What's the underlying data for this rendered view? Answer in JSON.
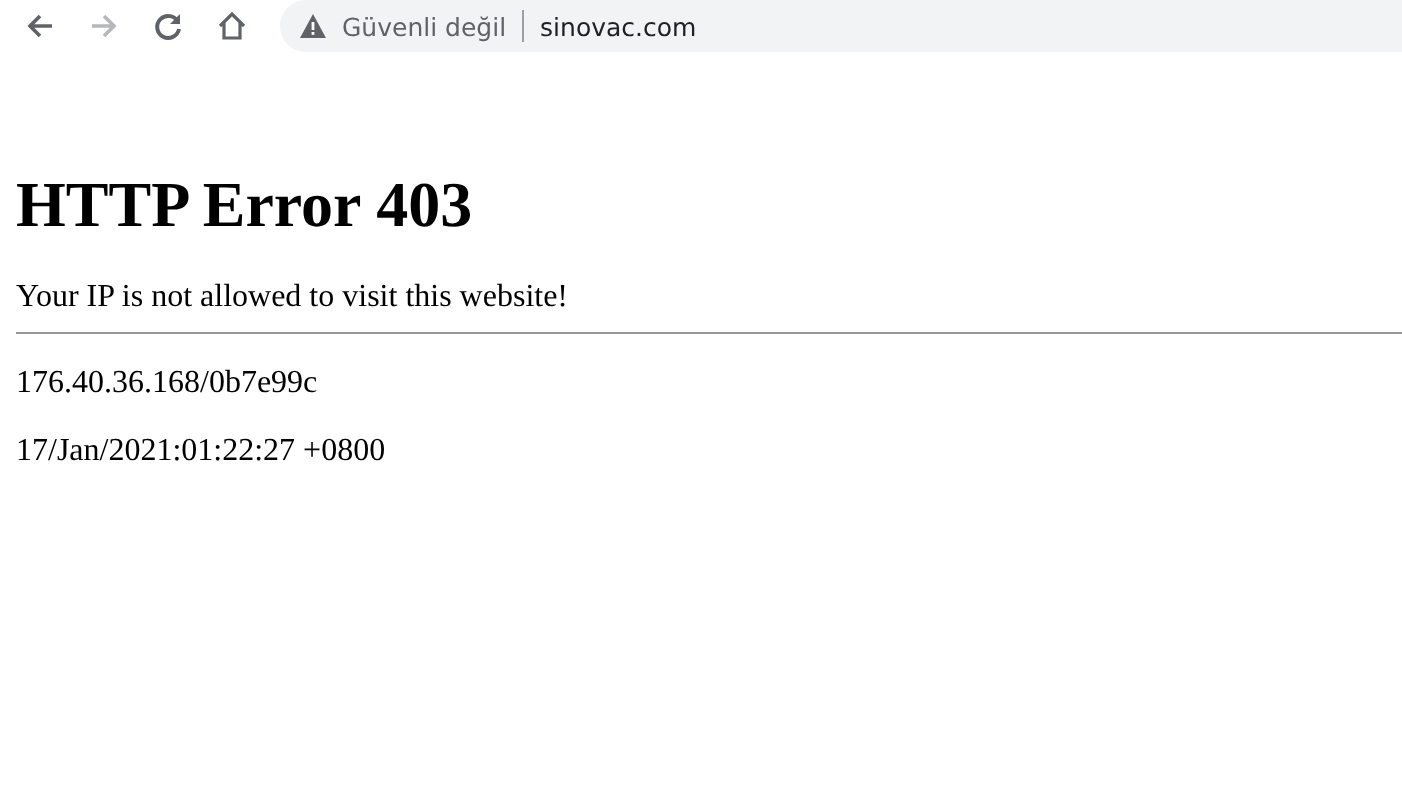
{
  "toolbar": {
    "buttons": [
      {
        "kind": "back",
        "disabled": false
      },
      {
        "kind": "forward",
        "disabled": true
      },
      {
        "kind": "reload",
        "disabled": false
      },
      {
        "kind": "home",
        "disabled": false
      }
    ],
    "address_bar": {
      "security": "Güvenli değil",
      "url": "sinovac.com"
    }
  },
  "page": {
    "heading": "HTTP Error 403",
    "message": "Your IP is not allowed to visit this website!",
    "details": [
      "176.40.36.168/0b7e99c",
      "17/Jan/2021:01:22:27 +0800"
    ]
  }
}
